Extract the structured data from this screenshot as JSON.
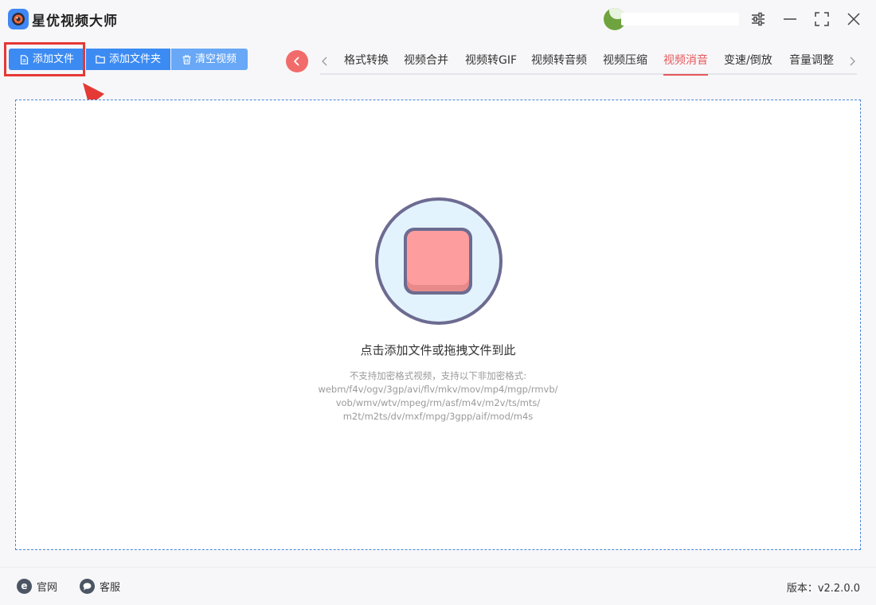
{
  "app": {
    "title": "星优视频大师"
  },
  "toolbar": {
    "add_file_label": "添加文件",
    "add_folder_label": "添加文件夹",
    "clear_label": "清空视频"
  },
  "tabs": [
    {
      "label": "格式转换",
      "active": false
    },
    {
      "label": "视频合并",
      "active": false
    },
    {
      "label": "视频转GIF",
      "active": false
    },
    {
      "label": "视频转音频",
      "active": false
    },
    {
      "label": "视频压缩",
      "active": false
    },
    {
      "label": "视频消音",
      "active": true
    },
    {
      "label": "变速/倒放",
      "active": false
    },
    {
      "label": "音量调整",
      "active": false
    }
  ],
  "dropzone": {
    "title": "点击添加文件或拖拽文件到此",
    "hint_lines": [
      "不支持加密格式视频，支持以下非加密格式:",
      "webm/f4v/ogv/3gp/avi/flv/mkv/mov/mp4/mgp/rmvb/",
      "vob/wmv/wtv/mpeg/rm/asf/m4v/m2v/ts/mts/",
      "m2t/m2ts/dv/mxf/mpg/3gpp/aif/mod/m4s"
    ]
  },
  "footer": {
    "website_label": "官网",
    "website_icon_glyph": "e",
    "support_label": "客服",
    "version_text": "版本：v2.2.0.0"
  },
  "colors": {
    "primary": "#3c8bf3",
    "primary_light": "#68a8f6",
    "accent_red": "#e6575a",
    "back_button": "#f26b6b",
    "highlight": "#e53935",
    "dropzone_border": "#4a86d8"
  },
  "icons": {
    "app_logo": "camera-lens-icon",
    "settings": "sliders-icon",
    "minimize": "minimize-icon",
    "maximize": "maximize-icon",
    "close": "close-icon",
    "back": "chevron-left-icon",
    "add_file": "file-icon",
    "add_folder": "folder-icon",
    "clear": "trash-icon",
    "drop": "stop-square-icon",
    "website": "browser-e-icon",
    "support": "chat-bubble-icon"
  }
}
